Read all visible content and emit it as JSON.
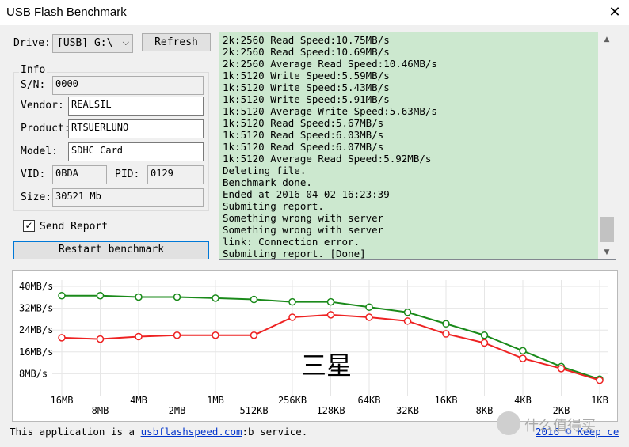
{
  "window": {
    "title": "USB Flash Benchmark",
    "close_glyph": "✕"
  },
  "controls": {
    "drive_label": "Drive:",
    "drive_value": "[USB] G:\\",
    "refresh_label": "Refresh",
    "send_report_label": "Send Report",
    "send_report_checked": true,
    "restart_label": "Restart benchmark"
  },
  "info": {
    "title": "Info",
    "sn_label": "S/N:",
    "sn_value": "0000",
    "vendor_label": "Vendor:",
    "vendor_value": "REALSIL",
    "product_label": "Product:",
    "product_value": "RTSUERLUNO",
    "model_label": "Model:",
    "model_value": "SDHC Card",
    "vid_label": "VID:",
    "vid_value": "0BDA",
    "pid_label": "PID:",
    "pid_value": "0129",
    "size_label": "Size:",
    "size_value": "30521 Mb"
  },
  "log": {
    "lines": [
      "2k:2560 Read Speed:10.75MB/s",
      "2k:2560 Read Speed:10.69MB/s",
      "2k:2560 Average Read Speed:10.46MB/s",
      "1k:5120 Write Speed:5.59MB/s",
      "1k:5120 Write Speed:5.43MB/s",
      "1k:5120 Write Speed:5.91MB/s",
      "1k:5120 Average Write Speed:5.63MB/s",
      "1k:5120 Read Speed:5.67MB/s",
      "1k:5120 Read Speed:6.03MB/s",
      "1k:5120 Read Speed:6.07MB/s",
      "1k:5120 Average Read Speed:5.92MB/s",
      "Deleting file.",
      "Benchmark done.",
      "Ended at 2016-04-02 16:23:39",
      "Submiting report.",
      "Something wrong with server",
      "Something wrong with server",
      "link: Connection error.",
      "Submiting report. [Done]"
    ]
  },
  "footer": {
    "prefix": "This application is a ",
    "link": "usbflashspeed.com",
    "suffix": ":b service.",
    "right": "2016 © Keep ce",
    "watermark": "什么值得买"
  },
  "colors": {
    "read": "#1a8a1a",
    "write": "#ee2222",
    "log_bg": "#cce8cf"
  },
  "chart_data": {
    "type": "line",
    "categories": [
      "16MB",
      "8MB",
      "4MB",
      "2MB",
      "1MB",
      "512KB",
      "256KB",
      "128KB",
      "64KB",
      "32KB",
      "16KB",
      "8KB",
      "4KB",
      "2KB",
      "1KB"
    ],
    "series": [
      {
        "color": "#1a8a1a",
        "values": [
          36.6,
          36.6,
          36.1,
          36.1,
          35.7,
          35.2,
          34.3,
          34.3,
          32.4,
          30.5,
          26.3,
          22.1,
          16.4,
          10.6,
          6.0
        ]
      },
      {
        "color": "#ee2222",
        "values": [
          21.2,
          20.7,
          21.6,
          22.1,
          22.1,
          22.1,
          28.7,
          29.6,
          28.7,
          27.3,
          22.6,
          19.3,
          13.6,
          9.9,
          5.6
        ]
      }
    ],
    "y_ticks": [
      "40MB/s",
      "32MB/s",
      "24MB/s",
      "16MB/s",
      "8MB/s"
    ],
    "y_tick_values": [
      40,
      32,
      24,
      16,
      8
    ],
    "ylim": [
      0,
      40
    ],
    "annotation": "三星",
    "grid": true
  }
}
